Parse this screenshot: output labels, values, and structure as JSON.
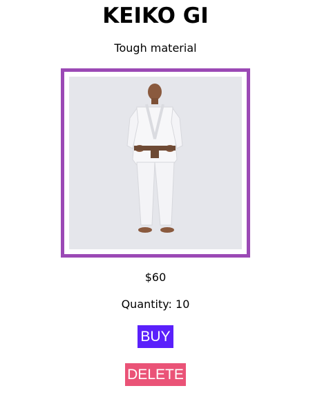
{
  "product": {
    "title": "KEIKO GI",
    "description": "Tough material",
    "image_alt": "Model wearing a white Keiko jiu-jitsu gi with a brown belt",
    "price": "$60",
    "quantity_label": "Quantity:",
    "quantity_value": "10"
  },
  "actions": {
    "buy_label": "BUY",
    "delete_label": "DELETE"
  },
  "colors": {
    "image_border": "#9b49b5",
    "buy_button": "#5a20fb",
    "delete_button": "#ea5377",
    "photo_background": "#e5e6eb"
  }
}
